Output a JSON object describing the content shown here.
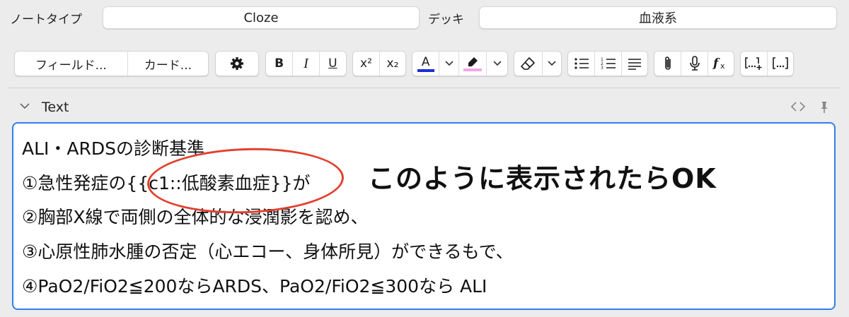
{
  "header": {
    "notetype_label": "ノートタイプ",
    "notetype_value": "Cloze",
    "deck_label": "デッキ",
    "deck_value": "血液系"
  },
  "toolbar": {
    "fields_button": "フィールド...",
    "cards_button": "カード...",
    "bold": "B",
    "italic": "I",
    "underline": "U",
    "superscript": "x²",
    "subscript": "x₂",
    "text_color_letter": "A",
    "text_color": "#1a2fd6",
    "highlight_color": "#f4a6e8",
    "icons": [
      "gear-icon",
      "chevron-down-icon",
      "highlighter-icon",
      "eraser-icon",
      "bullet-list-icon",
      "numbered-list-icon",
      "align-icon",
      "paperclip-icon",
      "microphone-icon",
      "function-icon",
      "cloze-new-icon",
      "cloze-same-icon"
    ]
  },
  "field": {
    "name": "Text",
    "lines": [
      "ALI・ARDSの診断基準",
      "①急性発症の{{c1::低酸素血症}}が",
      "②胸部X線で両側の全体的な浸潤影を認め、",
      "③心原性肺水腫の否定（心エコー、身体所見）ができるもで、",
      "④PaO2/FiO2≦200ならARDS、PaO2/FiO2≦300なら ALI"
    ]
  },
  "annotation": {
    "text": "このように表示されたらOK",
    "circle_color": "#e2402e"
  },
  "accent_color": "#2f7ff0"
}
